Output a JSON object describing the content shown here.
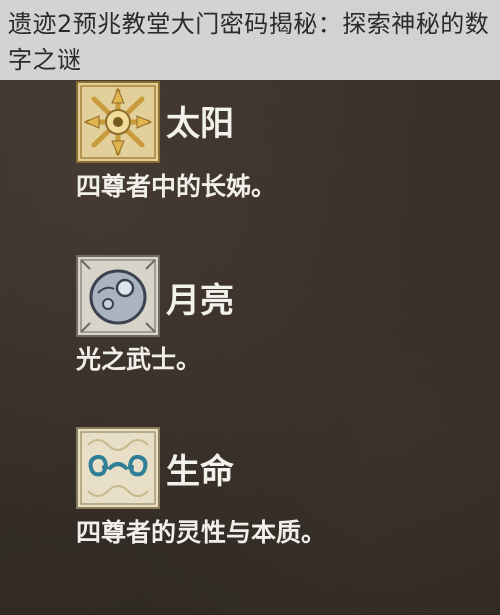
{
  "header": {
    "title": "遗迹2预兆教堂大门密码揭秘：探索神秘的数字之谜"
  },
  "entries": [
    {
      "name": "太阳",
      "description": "四尊者中的长姊。",
      "icon": "sun-emblem-icon",
      "accent": "#d8a94a"
    },
    {
      "name": "月亮",
      "description": "光之武士。",
      "icon": "moon-emblem-icon",
      "accent": "#9aa6b2"
    },
    {
      "name": "生命",
      "description": "四尊者的灵性与本质。",
      "icon": "life-emblem-icon",
      "accent": "#3c8aa0"
    }
  ],
  "colors": {
    "background": "#3a322c",
    "text": "#f3f1ec",
    "title_band": "#e8e8e8"
  }
}
